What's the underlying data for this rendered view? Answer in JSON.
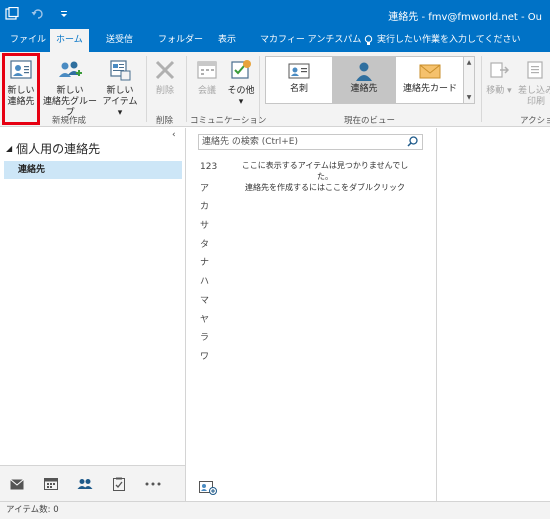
{
  "titlebar": {
    "title": "連絡先 - fmv@fmworld.net - Ou"
  },
  "tabs": [
    {
      "label": "ファイル"
    },
    {
      "label": "ホーム"
    },
    {
      "label": "送受信"
    },
    {
      "label": "フォルダー"
    },
    {
      "label": "表示"
    },
    {
      "label": "マカフィー アンチスパム"
    }
  ],
  "tellme": {
    "label": "実行したい作業を入力してください"
  },
  "ribbon": {
    "new_contact": "新しい\n連絡先",
    "new_group": "新しい\n連絡先グループ",
    "new_items": "新しい\nアイテム",
    "group_new": "新規作成",
    "delete": "削除",
    "group_delete": "削除",
    "meeting": "会議",
    "more": "その他",
    "group_comm": "コミュニケーション",
    "view_card": "名刺",
    "view_people": "連絡先",
    "view_contactcard": "連絡先カード",
    "group_view": "現在のビュー",
    "move": "移動",
    "mailmerge": "差し込み\n印刷",
    "group_action": "アクション"
  },
  "leftpane": {
    "header": "個人用の連絡先",
    "folder": "連絡先"
  },
  "midpane": {
    "search_placeholder": "連絡先 の検索 (Ctrl+E)",
    "alpha": [
      "123",
      "ア",
      "カ",
      "サ",
      "タ",
      "ナ",
      "ハ",
      "マ",
      "ヤ",
      "ラ",
      "ワ"
    ],
    "empty_line1": "ここに表示するアイテムは見つかりませんでした。",
    "empty_line2": "連絡先を作成するにはここをダブルクリック"
  },
  "statusbar": {
    "text": "アイテム数: 0"
  },
  "colors": {
    "accent": "#0072c6",
    "highlight": "#e60012",
    "selected_folder": "#cde6f7"
  }
}
